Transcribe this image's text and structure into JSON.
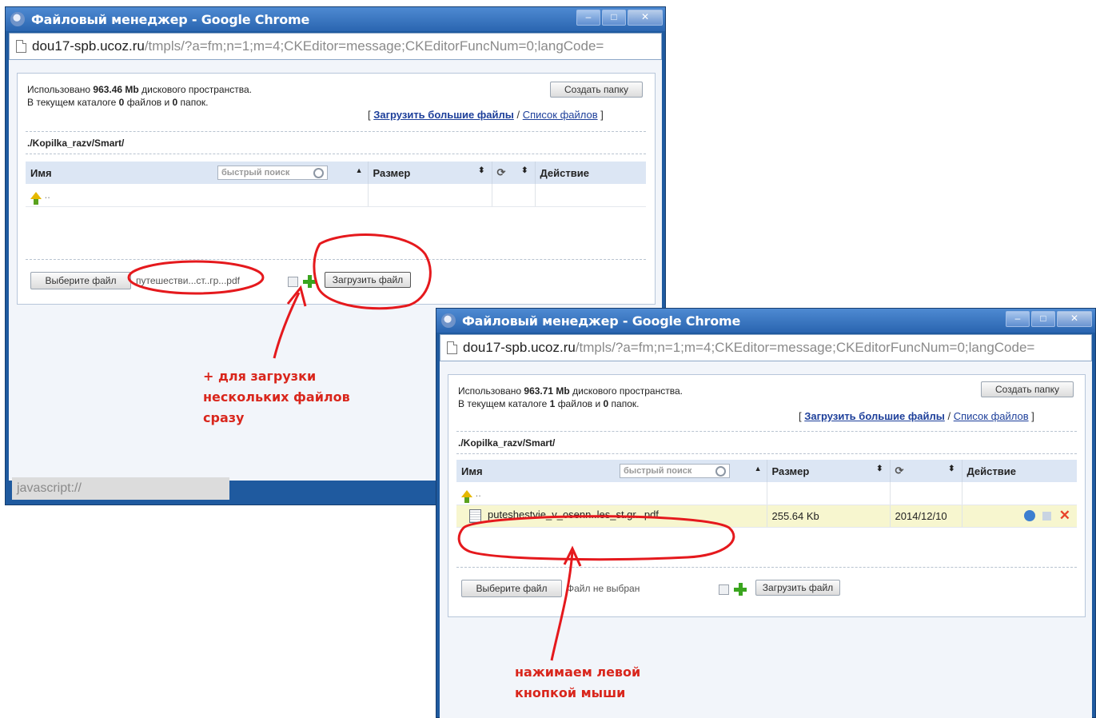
{
  "window1": {
    "title": "Файловый менеджер - Google Chrome",
    "url_host": "dou17-spb.ucoz.ru",
    "url_path": "/tmpls/?a=fm;n=1;m=4;CKEditor=message;CKEditorFuncNum=0;langCode=",
    "used_prefix": "Использовано",
    "used_value": "963.46 Mb",
    "used_suffix": "дискового пространства.",
    "dir_prefix": "В текущем каталоге",
    "files_count": "0",
    "files_mid": "файлов и",
    "folders_count": "0",
    "folders_suffix": "папок.",
    "create_folder": "Создать папку",
    "bracket_open": "[",
    "upload_big_link": "Загрузить большие файлы",
    "slash": "/",
    "file_list_link": "Список файлов",
    "bracket_close": "]",
    "path": "./Kopilka_razv/Smart/",
    "col_name": "Имя",
    "search_placeholder": "быстрый поиск",
    "col_size": "Размер",
    "col_action": "Действие",
    "up_text": "..",
    "choose_file": "Выберите файл",
    "chosen_file": "путешестви...ст..гр...pdf",
    "upload_button": "Загрузить файл",
    "status": "javascript://"
  },
  "window2": {
    "title": "Файловый менеджер - Google Chrome",
    "url_host": "dou17-spb.ucoz.ru",
    "url_path": "/tmpls/?a=fm;n=1;m=4;CKEditor=message;CKEditorFuncNum=0;langCode=",
    "used_prefix": "Использовано",
    "used_value": "963.71 Mb",
    "used_suffix": "дискового пространства.",
    "dir_prefix": "В текущем каталоге",
    "files_count": "1",
    "files_mid": "файлов и",
    "folders_count": "0",
    "folders_suffix": "папок.",
    "create_folder": "Создать папку",
    "bracket_open": "[",
    "upload_big_link": "Загрузить большие файлы",
    "slash": "/",
    "file_list_link": "Список файлов",
    "bracket_close": "]",
    "path": "./Kopilka_razv/Smart/",
    "col_name": "Имя",
    "search_placeholder": "быстрый поиск",
    "col_size": "Размер",
    "col_action": "Действие",
    "up_text": "..",
    "file_row": {
      "name": "puteshestvie_v_osenn..les_st.gr...pdf",
      "size": "255.64 Kb",
      "date": "2014/12/10"
    },
    "choose_file": "Выберите файл",
    "chosen_file": "Файл не выбран",
    "upload_button": "Загрузить файл"
  },
  "annotations": {
    "plus_note": "+ для загрузки\nнескольких файлов\nсразу",
    "click_note": "нажимаем левой\nкнопкой мыши"
  },
  "colors": {
    "annotation": "#d9261c",
    "title_bar": "#2a65b0",
    "highlight_row": "#f7f6cf"
  }
}
